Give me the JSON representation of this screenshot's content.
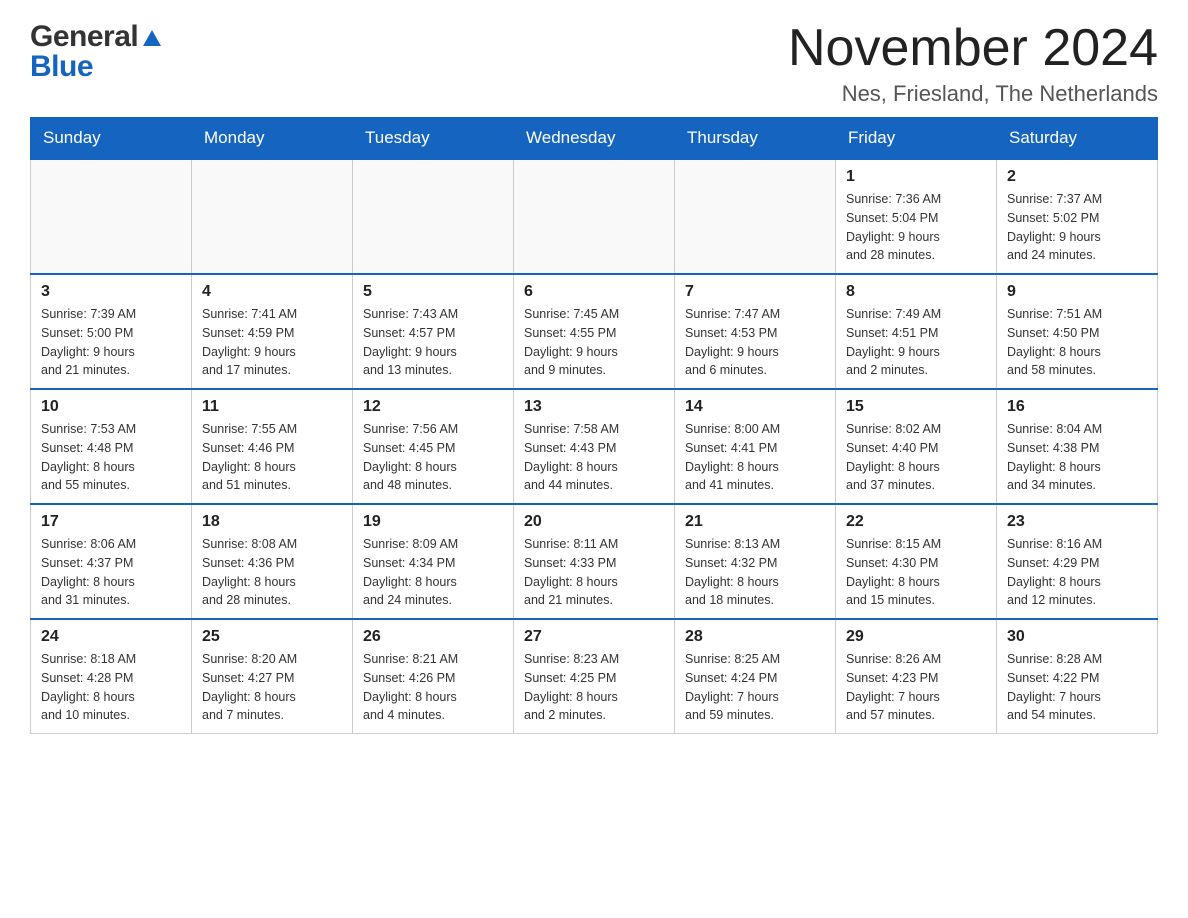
{
  "header": {
    "logo_general": "General",
    "logo_blue": "Blue",
    "month_title": "November 2024",
    "location": "Nes, Friesland, The Netherlands"
  },
  "weekdays": [
    "Sunday",
    "Monday",
    "Tuesday",
    "Wednesday",
    "Thursday",
    "Friday",
    "Saturday"
  ],
  "weeks": [
    [
      {
        "day": "",
        "info": ""
      },
      {
        "day": "",
        "info": ""
      },
      {
        "day": "",
        "info": ""
      },
      {
        "day": "",
        "info": ""
      },
      {
        "day": "",
        "info": ""
      },
      {
        "day": "1",
        "info": "Sunrise: 7:36 AM\nSunset: 5:04 PM\nDaylight: 9 hours\nand 28 minutes."
      },
      {
        "day": "2",
        "info": "Sunrise: 7:37 AM\nSunset: 5:02 PM\nDaylight: 9 hours\nand 24 minutes."
      }
    ],
    [
      {
        "day": "3",
        "info": "Sunrise: 7:39 AM\nSunset: 5:00 PM\nDaylight: 9 hours\nand 21 minutes."
      },
      {
        "day": "4",
        "info": "Sunrise: 7:41 AM\nSunset: 4:59 PM\nDaylight: 9 hours\nand 17 minutes."
      },
      {
        "day": "5",
        "info": "Sunrise: 7:43 AM\nSunset: 4:57 PM\nDaylight: 9 hours\nand 13 minutes."
      },
      {
        "day": "6",
        "info": "Sunrise: 7:45 AM\nSunset: 4:55 PM\nDaylight: 9 hours\nand 9 minutes."
      },
      {
        "day": "7",
        "info": "Sunrise: 7:47 AM\nSunset: 4:53 PM\nDaylight: 9 hours\nand 6 minutes."
      },
      {
        "day": "8",
        "info": "Sunrise: 7:49 AM\nSunset: 4:51 PM\nDaylight: 9 hours\nand 2 minutes."
      },
      {
        "day": "9",
        "info": "Sunrise: 7:51 AM\nSunset: 4:50 PM\nDaylight: 8 hours\nand 58 minutes."
      }
    ],
    [
      {
        "day": "10",
        "info": "Sunrise: 7:53 AM\nSunset: 4:48 PM\nDaylight: 8 hours\nand 55 minutes."
      },
      {
        "day": "11",
        "info": "Sunrise: 7:55 AM\nSunset: 4:46 PM\nDaylight: 8 hours\nand 51 minutes."
      },
      {
        "day": "12",
        "info": "Sunrise: 7:56 AM\nSunset: 4:45 PM\nDaylight: 8 hours\nand 48 minutes."
      },
      {
        "day": "13",
        "info": "Sunrise: 7:58 AM\nSunset: 4:43 PM\nDaylight: 8 hours\nand 44 minutes."
      },
      {
        "day": "14",
        "info": "Sunrise: 8:00 AM\nSunset: 4:41 PM\nDaylight: 8 hours\nand 41 minutes."
      },
      {
        "day": "15",
        "info": "Sunrise: 8:02 AM\nSunset: 4:40 PM\nDaylight: 8 hours\nand 37 minutes."
      },
      {
        "day": "16",
        "info": "Sunrise: 8:04 AM\nSunset: 4:38 PM\nDaylight: 8 hours\nand 34 minutes."
      }
    ],
    [
      {
        "day": "17",
        "info": "Sunrise: 8:06 AM\nSunset: 4:37 PM\nDaylight: 8 hours\nand 31 minutes."
      },
      {
        "day": "18",
        "info": "Sunrise: 8:08 AM\nSunset: 4:36 PM\nDaylight: 8 hours\nand 28 minutes."
      },
      {
        "day": "19",
        "info": "Sunrise: 8:09 AM\nSunset: 4:34 PM\nDaylight: 8 hours\nand 24 minutes."
      },
      {
        "day": "20",
        "info": "Sunrise: 8:11 AM\nSunset: 4:33 PM\nDaylight: 8 hours\nand 21 minutes."
      },
      {
        "day": "21",
        "info": "Sunrise: 8:13 AM\nSunset: 4:32 PM\nDaylight: 8 hours\nand 18 minutes."
      },
      {
        "day": "22",
        "info": "Sunrise: 8:15 AM\nSunset: 4:30 PM\nDaylight: 8 hours\nand 15 minutes."
      },
      {
        "day": "23",
        "info": "Sunrise: 8:16 AM\nSunset: 4:29 PM\nDaylight: 8 hours\nand 12 minutes."
      }
    ],
    [
      {
        "day": "24",
        "info": "Sunrise: 8:18 AM\nSunset: 4:28 PM\nDaylight: 8 hours\nand 10 minutes."
      },
      {
        "day": "25",
        "info": "Sunrise: 8:20 AM\nSunset: 4:27 PM\nDaylight: 8 hours\nand 7 minutes."
      },
      {
        "day": "26",
        "info": "Sunrise: 8:21 AM\nSunset: 4:26 PM\nDaylight: 8 hours\nand 4 minutes."
      },
      {
        "day": "27",
        "info": "Sunrise: 8:23 AM\nSunset: 4:25 PM\nDaylight: 8 hours\nand 2 minutes."
      },
      {
        "day": "28",
        "info": "Sunrise: 8:25 AM\nSunset: 4:24 PM\nDaylight: 7 hours\nand 59 minutes."
      },
      {
        "day": "29",
        "info": "Sunrise: 8:26 AM\nSunset: 4:23 PM\nDaylight: 7 hours\nand 57 minutes."
      },
      {
        "day": "30",
        "info": "Sunrise: 8:28 AM\nSunset: 4:22 PM\nDaylight: 7 hours\nand 54 minutes."
      }
    ]
  ]
}
